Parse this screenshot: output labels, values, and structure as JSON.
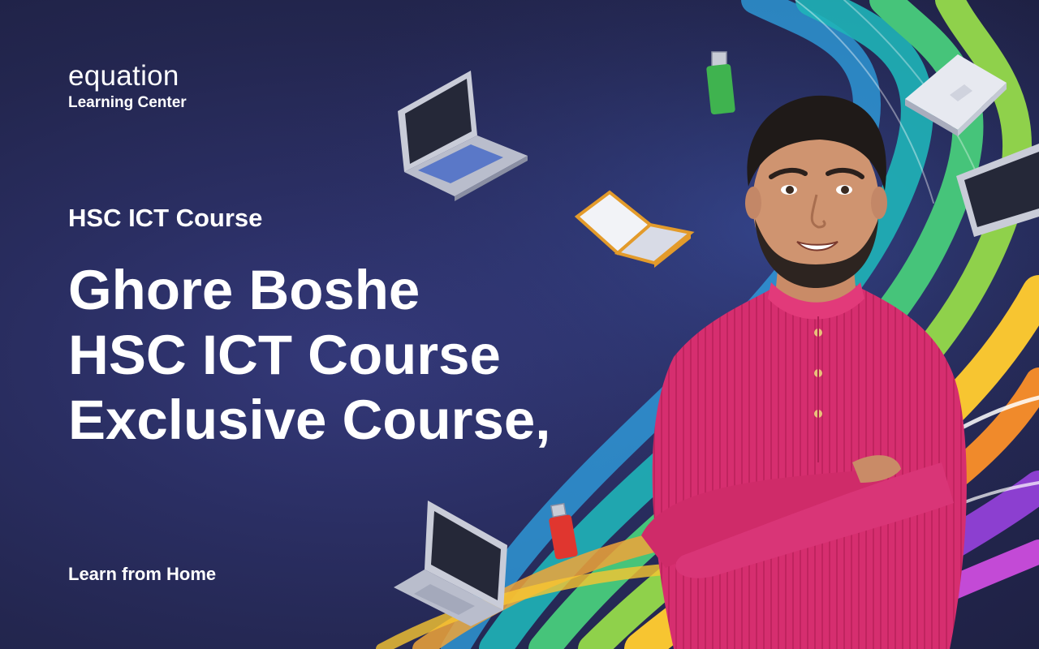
{
  "brand": {
    "name": "equation",
    "sub": "Learning Center"
  },
  "hero": {
    "kicker": "HSC ICT Course",
    "headline": [
      "Ghore Boshe",
      "HSC ICT Course",
      "Exclusive Course,"
    ],
    "tagline": "Learn from Home"
  },
  "icons": [
    "laptop-icon",
    "book-icon",
    "usb-drive-icon",
    "laptop-icon",
    "usb-drive-icon",
    "laptop-icon",
    "tablet-icon"
  ],
  "colors": {
    "background": "#262a58",
    "shirt": "#d62e6f",
    "swoosh_teal": "#1fb4b8",
    "swoosh_green": "#8fd14b",
    "swoosh_yellow": "#f7c531",
    "swoosh_orange": "#f08a2b",
    "swoosh_purple": "#8c3fd0",
    "text": "#ffffff"
  }
}
